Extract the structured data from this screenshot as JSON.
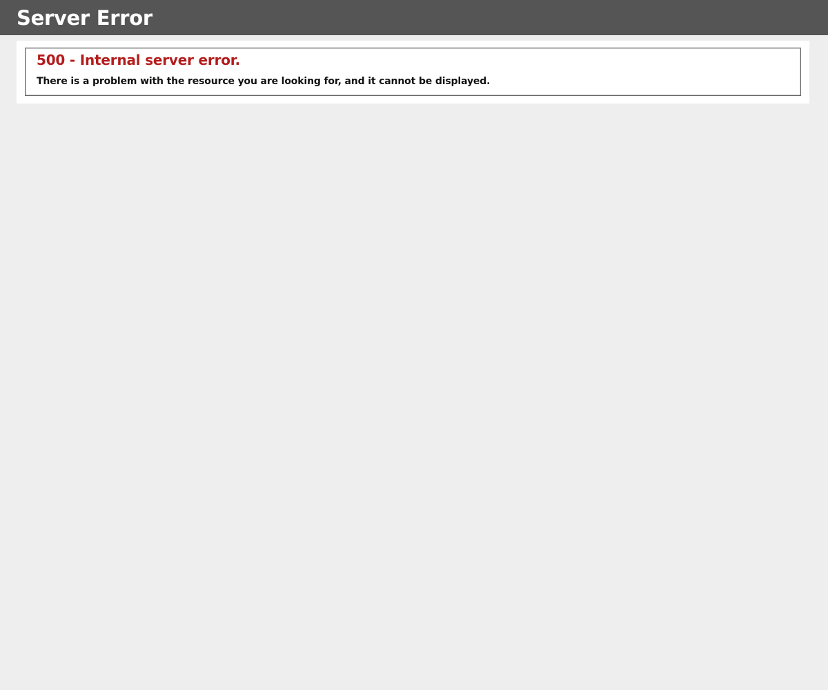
{
  "header": {
    "title": "Server Error"
  },
  "error": {
    "code_title": "500 - Internal server error.",
    "message": "There is a problem with the resource you are looking for, and it cannot be displayed."
  },
  "colors": {
    "header_background": "#555555",
    "page_background": "#eeeeee",
    "error_title": "#b41c1c",
    "content_background": "#ffffff"
  }
}
